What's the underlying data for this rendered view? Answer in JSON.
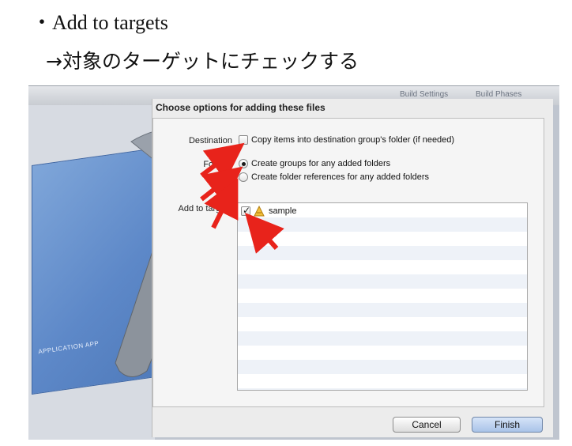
{
  "page": {
    "heading_line1": "・Add to targets",
    "heading_line2": "→対象のターゲットにチェックする"
  },
  "background_window": {
    "tabs": [
      "Build Settings",
      "Build Phases"
    ],
    "blueprint_label": "APPLICATION APP"
  },
  "dialog": {
    "title": "Choose options for adding these files",
    "destination": {
      "label": "Destination",
      "option_label": "Copy items into destination group's folder (if needed)",
      "checked": false
    },
    "folders": {
      "label": "Folders",
      "options": [
        {
          "label": "Create groups for any added folders",
          "selected": true
        },
        {
          "label": "Create folder references for any added folders",
          "selected": false
        }
      ]
    },
    "add_to_targets": {
      "label": "Add to targets",
      "items": [
        {
          "name": "sample",
          "checked": true,
          "icon": "app-target-icon"
        }
      ]
    },
    "buttons": {
      "cancel": "Cancel",
      "finish": "Finish"
    }
  },
  "annotations": {
    "arrow_color": "#e8231b",
    "arrow_count": 4
  }
}
